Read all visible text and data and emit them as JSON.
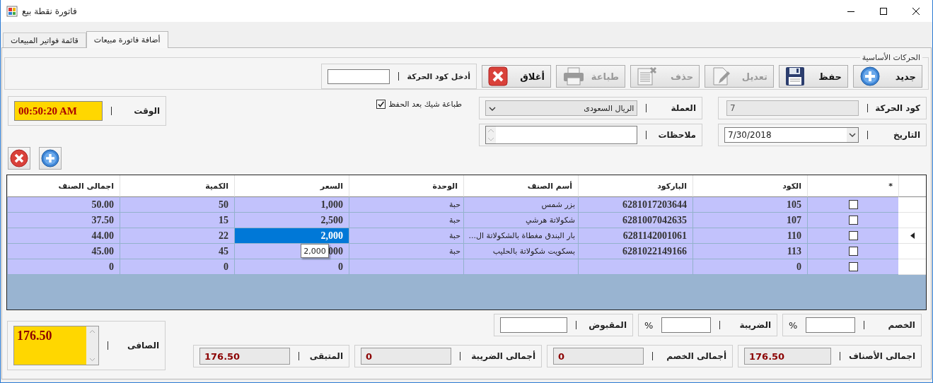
{
  "window": {
    "title": "فاتورة نقطة بيع"
  },
  "tabs": [
    {
      "label": "أضافة فاتورة مبيعات",
      "selected": true
    },
    {
      "label": "قائمة فواتير المبيعات",
      "selected": false
    }
  ],
  "toolbar": {
    "title": "الحركات الأساسية",
    "buttons": [
      {
        "label": "جديد",
        "kind": "new",
        "disabled": false
      },
      {
        "label": "حفظ",
        "kind": "save",
        "disabled": false
      },
      {
        "label": "تعديل",
        "kind": "edit",
        "disabled": true
      },
      {
        "label": "حذف",
        "kind": "delete",
        "disabled": true
      },
      {
        "label": "طباعة",
        "kind": "print",
        "disabled": true
      },
      {
        "label": "أغلاق",
        "kind": "close",
        "disabled": false
      }
    ],
    "lookup": {
      "label": "أدخل كود الحركة"
    }
  },
  "header": {
    "code": {
      "label": "كود الحركة",
      "value": "7"
    },
    "date": {
      "label": "التاريخ",
      "value": "7/30/2018"
    },
    "currency": {
      "label": "العملة",
      "value": "الريال السعودى"
    },
    "notes": {
      "label": "ملاحظات"
    },
    "print_check": {
      "label": "طباعة شيك بعد الحفظ",
      "checked": true
    },
    "time": {
      "label": "الوقت",
      "value": "00:50:20 AM"
    }
  },
  "grid": {
    "columns": [
      "*",
      "الكود",
      "الباركود",
      "أسم الصنف",
      "الوحدة",
      "السعر",
      "الكمية",
      "اجمالى الصنف"
    ],
    "rows": [
      {
        "current": false,
        "cells": [
          {
            "kind": "checkbox",
            "checked": false,
            "selected": false
          },
          {
            "kind": "text",
            "text": "105",
            "selected": false
          },
          {
            "kind": "text",
            "text": "6281017203644",
            "selected": false
          },
          {
            "kind": "text",
            "text": "بزر شمس",
            "selected": false
          },
          {
            "kind": "text",
            "text": "حبة",
            "selected": false
          },
          {
            "kind": "text",
            "text": "1,000",
            "selected": false
          },
          {
            "kind": "text",
            "text": "50",
            "selected": false
          },
          {
            "kind": "text",
            "text": "50.00",
            "selected": false
          }
        ]
      },
      {
        "current": false,
        "cells": [
          {
            "kind": "checkbox",
            "checked": false,
            "selected": false
          },
          {
            "kind": "text",
            "text": "107",
            "selected": false
          },
          {
            "kind": "text",
            "text": "6281007042635",
            "selected": false
          },
          {
            "kind": "text",
            "text": "شكولاتة هرشي",
            "selected": false
          },
          {
            "kind": "text",
            "text": "حبة",
            "selected": false
          },
          {
            "kind": "text",
            "text": "2,500",
            "selected": false
          },
          {
            "kind": "text",
            "text": "15",
            "selected": false
          },
          {
            "kind": "text",
            "text": "37.50",
            "selected": false
          }
        ]
      },
      {
        "current": true,
        "cells": [
          {
            "kind": "checkbox",
            "checked": false,
            "selected": false
          },
          {
            "kind": "text",
            "text": "110",
            "selected": false
          },
          {
            "kind": "text",
            "text": "6281142001061",
            "selected": false
          },
          {
            "kind": "text",
            "text": "بار البندق مغطاة بالشكولاتة ال...",
            "selected": false
          },
          {
            "kind": "text",
            "text": "حبة",
            "selected": false
          },
          {
            "kind": "text",
            "text": "2,000",
            "selected": true
          },
          {
            "kind": "text",
            "text": "22",
            "selected": false
          },
          {
            "kind": "text",
            "text": "44.00",
            "selected": false
          }
        ]
      },
      {
        "current": false,
        "cells": [
          {
            "kind": "checkbox",
            "checked": false,
            "selected": false
          },
          {
            "kind": "text",
            "text": "113",
            "selected": false
          },
          {
            "kind": "text",
            "text": "6281022149166",
            "selected": false
          },
          {
            "kind": "text",
            "text": "بسكويت شكولاتة بالحليب",
            "selected": false
          },
          {
            "kind": "text",
            "text": "حبة",
            "selected": false
          },
          {
            "kind": "text",
            "text": "000",
            "selected": false
          },
          {
            "kind": "text",
            "text": "45",
            "selected": false
          },
          {
            "kind": "text",
            "text": "45.00",
            "selected": false
          }
        ]
      },
      {
        "current": false,
        "cells": [
          {
            "kind": "checkbox",
            "checked": false,
            "selected": false
          },
          {
            "kind": "text",
            "text": "0",
            "selected": false
          },
          {
            "kind": "text",
            "selected": false
          },
          {
            "kind": "text",
            "selected": false
          },
          {
            "kind": "text",
            "selected": false
          },
          {
            "kind": "text",
            "text": "0",
            "selected": false
          },
          {
            "kind": "text",
            "text": "0",
            "selected": false
          },
          {
            "kind": "text",
            "text": "0",
            "selected": false
          }
        ]
      }
    ],
    "tooltip": {
      "text": "2,000"
    }
  },
  "inputs": [
    {
      "label": "الخصم",
      "unit": "%"
    },
    {
      "label": "الضريبة",
      "unit": "%"
    },
    {
      "label": "المقبوض"
    }
  ],
  "totals": [
    {
      "label": "اجمالى الأصناف",
      "value": "176.50"
    },
    {
      "label": "أجمالى الخصم",
      "value": "0"
    },
    {
      "label": "أجمالى الضريبة",
      "value": "0"
    },
    {
      "label": "المتبقى",
      "value": "176.50"
    }
  ],
  "net": {
    "label": "الصافى",
    "value": "176.50"
  }
}
